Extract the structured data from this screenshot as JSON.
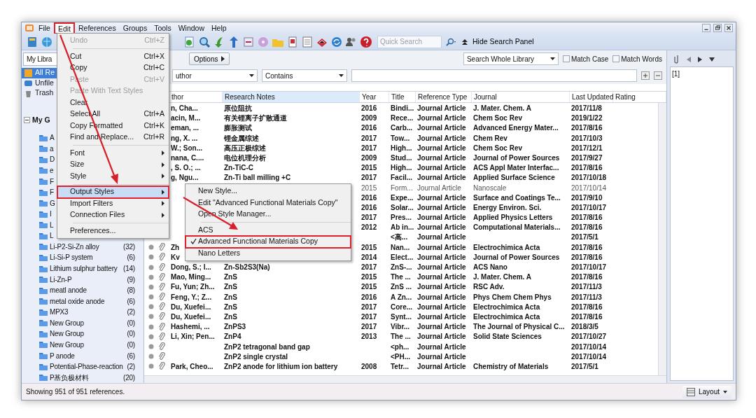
{
  "menubar": {
    "items": [
      {
        "label": "File",
        "selected": false,
        "annotated": false
      },
      {
        "label": "Edit",
        "selected": true,
        "annotated": true
      },
      {
        "label": "References",
        "selected": false,
        "annotated": false
      },
      {
        "label": "Groups",
        "selected": false,
        "annotated": false
      },
      {
        "label": "Tools",
        "selected": false,
        "annotated": false
      },
      {
        "label": "Window",
        "selected": false,
        "annotated": false
      },
      {
        "label": "Help",
        "selected": false,
        "annotated": false
      }
    ]
  },
  "toolbar": {
    "quick_search": {
      "placeholder": "Quick Search"
    },
    "hide_panel_button": "Hide Search Panel"
  },
  "edit_menu": {
    "items": [
      {
        "kind": "item",
        "label": "Undo",
        "shortcut": "Ctrl+Z",
        "disabled": true,
        "submenu": false,
        "selected": false,
        "annotated": false
      },
      {
        "kind": "separator"
      },
      {
        "kind": "item",
        "label": "Cut",
        "shortcut": "Ctrl+X",
        "disabled": false,
        "submenu": false,
        "selected": false,
        "annotated": false
      },
      {
        "kind": "item",
        "label": "Copy",
        "shortcut": "Ctrl+C",
        "disabled": false,
        "submenu": false,
        "selected": false,
        "annotated": false
      },
      {
        "kind": "item",
        "label": "Paste",
        "shortcut": "Ctrl+V",
        "disabled": true,
        "submenu": false,
        "selected": false,
        "annotated": false
      },
      {
        "kind": "item",
        "label": "Paste With Text Styles",
        "disabled": true,
        "submenu": false,
        "selected": false,
        "annotated": false
      },
      {
        "kind": "item",
        "label": "Clear",
        "disabled": false,
        "submenu": false,
        "selected": false,
        "annotated": false
      },
      {
        "kind": "item",
        "label": "Select All",
        "shortcut": "Ctrl+A",
        "disabled": false,
        "submenu": false,
        "selected": false,
        "annotated": false
      },
      {
        "kind": "item",
        "label": "Copy Formatted",
        "shortcut": "Ctrl+K",
        "disabled": false,
        "submenu": false,
        "selected": false,
        "annotated": false
      },
      {
        "kind": "item",
        "label": "Find and Replace...",
        "shortcut": "Ctrl+R",
        "disabled": false,
        "submenu": false,
        "selected": false,
        "annotated": false
      },
      {
        "kind": "separator"
      },
      {
        "kind": "item",
        "label": "Font",
        "disabled": false,
        "submenu": true,
        "selected": false,
        "annotated": false
      },
      {
        "kind": "item",
        "label": "Size",
        "disabled": false,
        "submenu": true,
        "selected": false,
        "annotated": false
      },
      {
        "kind": "item",
        "label": "Style",
        "disabled": false,
        "submenu": true,
        "selected": false,
        "annotated": false
      },
      {
        "kind": "separator"
      },
      {
        "kind": "item",
        "label": "Output Styles",
        "disabled": false,
        "submenu": true,
        "selected": true,
        "annotated": true
      },
      {
        "kind": "item",
        "label": "Import Filters",
        "disabled": false,
        "submenu": true,
        "selected": false,
        "annotated": false
      },
      {
        "kind": "item",
        "label": "Connection Files",
        "disabled": false,
        "submenu": true,
        "selected": false,
        "annotated": false
      },
      {
        "kind": "separator"
      },
      {
        "kind": "item",
        "label": "Preferences...",
        "disabled": false,
        "submenu": false,
        "selected": false,
        "annotated": false
      }
    ]
  },
  "output_styles_menu": {
    "items": [
      {
        "kind": "item",
        "label": "New Style...",
        "checked": false,
        "annotated": false
      },
      {
        "kind": "item",
        "label": "Edit \"Advanced Functional Materials Copy\"",
        "checked": false,
        "annotated": false
      },
      {
        "kind": "item",
        "label": "Open Style Manager...",
        "checked": false,
        "annotated": false
      },
      {
        "kind": "separator"
      },
      {
        "kind": "item",
        "label": "ACS",
        "checked": false,
        "annotated": false
      },
      {
        "kind": "item",
        "label": "Advanced Functional Materials Copy",
        "checked": true,
        "annotated": true
      },
      {
        "kind": "item",
        "label": "Nano Letters",
        "checked": false,
        "annotated": false
      }
    ]
  },
  "sidebar": {
    "library_dropdown": "My Libra",
    "items": [
      {
        "label": "All Re",
        "selected": true
      },
      {
        "label": "Unfile",
        "selected": false
      },
      {
        "label": "Trash",
        "selected": false
      }
    ],
    "group_set": {
      "label": "My G",
      "expanded": true,
      "groups": [
        {
          "name": "A"
        },
        {
          "name": "a"
        },
        {
          "name": "D"
        },
        {
          "name": "e"
        },
        {
          "name": "F"
        },
        {
          "name": "F"
        },
        {
          "name": "G"
        },
        {
          "name": "I"
        },
        {
          "name": "L"
        },
        {
          "name": "L"
        },
        {
          "name": "Li-P2-Si-Zn alloy",
          "count": "(32)"
        },
        {
          "name": "Li-Si-P system",
          "count": "(6)"
        },
        {
          "name": "Lithium sulphur battery",
          "count": "(14)"
        },
        {
          "name": "Li-Zn-P",
          "count": "(9)"
        },
        {
          "name": "meatl anode",
          "count": "(8)"
        },
        {
          "name": "metal oxide anode",
          "count": "(6)"
        },
        {
          "name": "MPX3",
          "count": "(2)"
        },
        {
          "name": "New Group",
          "count": "(0)"
        },
        {
          "name": "New Group",
          "count": "(0)"
        },
        {
          "name": "New Group",
          "count": "(0)"
        },
        {
          "name": "P anode",
          "count": "(6)"
        },
        {
          "name": "Potential-Phase-reaction",
          "count": "(2)"
        },
        {
          "name": "P基负极材料",
          "count": "(20)"
        }
      ]
    }
  },
  "search_panel": {
    "options_button": "Options",
    "scope": "Search Whole Library",
    "match_case": {
      "label": "Match Case",
      "checked": false
    },
    "match_words": {
      "label": "Match Words",
      "checked": false
    },
    "field": "uthor",
    "operator": "Contains"
  },
  "table": {
    "columns": [
      {
        "label": "thor",
        "sorted": false
      },
      {
        "label": "Research Notes",
        "sorted": true
      },
      {
        "label": "Year",
        "sorted": false
      },
      {
        "label": "Title",
        "sorted": false
      },
      {
        "label": "Reference Type",
        "sorted": false
      },
      {
        "label": "Journal",
        "sorted": false
      },
      {
        "label": "Last Updated",
        "sorted": false
      },
      {
        "label": "Rating",
        "sorted": false
      }
    ],
    "rows": [
      {
        "author": "n, Cha...",
        "notes": "原位阻抗",
        "year": "2016",
        "title": "Bindi...",
        "type": "Journal Article",
        "journal": "J. Mater. Chem. A",
        "updated": "2017/11/8",
        "unread": true
      },
      {
        "author": "acin, M...",
        "notes": "有关锂离子扩散通道",
        "year": "2009",
        "title": "Rece...",
        "type": "Journal Article",
        "journal": "Chem Soc Rev",
        "updated": "2019/1/22",
        "unread": true
      },
      {
        "author": "eman, ...",
        "notes": "膨胀测试",
        "year": "2016",
        "title": "Carb...",
        "type": "Journal Article",
        "journal": "Advanced Energy Mater...",
        "updated": "2017/8/16",
        "unread": true
      },
      {
        "author": "ng, X. ...",
        "notes": "锂金属综述",
        "year": "2017",
        "title": "Tow...",
        "type": "Journal Article",
        "journal": "Chem Rev",
        "updated": "2017/10/3",
        "unread": true
      },
      {
        "author": "W.; Son...",
        "notes": "高压正极综述",
        "year": "2017",
        "title": "High...",
        "type": "Journal Article",
        "journal": "Chem Soc Rev",
        "updated": "2017/12/1",
        "unread": true
      },
      {
        "author": "nana, C....",
        "notes": "电位机理分析",
        "year": "2009",
        "title": "Stud...",
        "type": "Journal Article",
        "journal": "Journal of Power Sources",
        "updated": "2017/9/27",
        "unread": true
      },
      {
        "author": ", S. O.; ...",
        "notes": "Zn-TiC-C",
        "year": "2015",
        "title": "High...",
        "type": "Journal Article",
        "journal": "ACS Appl Mater Interfac...",
        "updated": "2017/8/16",
        "unread": true
      },
      {
        "author": "g, Ngu...",
        "notes": "Zn-Ti ball milling +C",
        "year": "2017",
        "title": "Facil...",
        "type": "Journal Article",
        "journal": "Applied Surface Science",
        "updated": "2017/10/18",
        "unread": true
      },
      {
        "year": "2015",
        "title": "Form...",
        "type": "Journal Article",
        "journal": "Nanoscale",
        "updated": "2017/10/14",
        "unread": false
      },
      {
        "year": "2016",
        "title": "Expe...",
        "type": "Journal Article",
        "journal": "Surface and Coatings Te...",
        "updated": "2017/9/10",
        "unread": true
      },
      {
        "year": "2016",
        "title": "Solar...",
        "type": "Journal Article",
        "journal": "Energy Environ. Sci.",
        "updated": "2017/10/17",
        "unread": true
      },
      {
        "year": "2017",
        "title": "Pres...",
        "type": "Journal Article",
        "journal": "Applied Physics Letters",
        "updated": "2017/8/16",
        "unread": true
      },
      {
        "year": "2012",
        "title": "Ab in...",
        "type": "Journal Article",
        "journal": "Computational Materials...",
        "updated": "2017/8/16",
        "unread": true
      },
      {
        "title": "<高...",
        "type": "Journal Article",
        "updated": "2017/5/1",
        "unread": true
      },
      {
        "attachment": true,
        "author": "Zh",
        "year": "2015",
        "title": "Nan...",
        "type": "Journal Article",
        "journal": "Electrochimica Acta",
        "updated": "2017/8/16",
        "unread": true
      },
      {
        "attachment": true,
        "author": "Kv",
        "year": "2014",
        "title": "Elect...",
        "type": "Journal Article",
        "journal": "Journal of Power Sources",
        "updated": "2017/8/16",
        "unread": true
      },
      {
        "attachment": true,
        "author": "Dong, S.; I...",
        "notes": "Zn-Sb2S3(Na)",
        "year": "2017",
        "title": "ZnS-...",
        "type": "Journal Article",
        "journal": "ACS Nano",
        "updated": "2017/10/17",
        "unread": true
      },
      {
        "attachment": true,
        "author": "Mao, Ming...",
        "notes": "ZnS",
        "year": "2015",
        "title": "The ...",
        "type": "Journal Article",
        "journal": "J. Mater. Chem. A",
        "updated": "2017/8/16",
        "unread": true
      },
      {
        "attachment": true,
        "author": "Fu, Yun; Zh...",
        "notes": "ZnS",
        "year": "2015",
        "title": "ZnS ...",
        "type": "Journal Article",
        "journal": "RSC Adv.",
        "updated": "2017/11/3",
        "unread": true
      },
      {
        "attachment": true,
        "author": "Feng, Y.; Z...",
        "notes": "ZnS",
        "year": "2016",
        "title": "A Zn...",
        "type": "Journal Article",
        "journal": "Phys Chem Chem Phys",
        "updated": "2017/11/3",
        "unread": true
      },
      {
        "attachment": true,
        "author": "Du, Xuefei...",
        "notes": "ZnS",
        "year": "2017",
        "title": "Core...",
        "type": "Journal Article",
        "journal": "Electrochimica Acta",
        "updated": "2017/8/16",
        "unread": true
      },
      {
        "attachment": true,
        "author": "Du, Xuefei...",
        "notes": "ZnS",
        "year": "2017",
        "title": "Synt...",
        "type": "Journal Article",
        "journal": "Electrochimica Acta",
        "updated": "2017/8/16",
        "unread": true
      },
      {
        "attachment": true,
        "author": "Hashemi, ...",
        "notes": "ZnPS3",
        "year": "2017",
        "title": "Vibr...",
        "type": "Journal Article",
        "journal": "The Journal of Physical C...",
        "updated": "2018/3/5",
        "unread": true
      },
      {
        "attachment": true,
        "author": "Li, Xin; Pen...",
        "notes": "ZnP4",
        "year": "2013",
        "title": "The ...",
        "type": "Journal Article",
        "journal": "Solid State Sciences",
        "updated": "2017/10/27",
        "unread": true
      },
      {
        "attachment": true,
        "notes": "ZnP2 tetragonal band gap",
        "title": "<ph...",
        "type": "Journal Article",
        "updated": "2017/10/14",
        "unread": true
      },
      {
        "attachment": true,
        "notes": "ZnP2 single crystal",
        "title": "<PH...",
        "type": "Journal Article",
        "updated": "2017/10/14",
        "unread": true
      },
      {
        "attachment": true,
        "author": "Park, Cheo...",
        "notes": "ZnP2 anode for lithium ion battery",
        "year": "2008",
        "title": "Tetr...",
        "type": "Journal Article",
        "journal": "Chemistry of Materials",
        "updated": "2017/5/1",
        "unread": true
      }
    ]
  },
  "preview": {
    "text": "[1]"
  },
  "status_bar": {
    "text": "Showing 951 of 951 references.",
    "layout_button": "Layout"
  }
}
